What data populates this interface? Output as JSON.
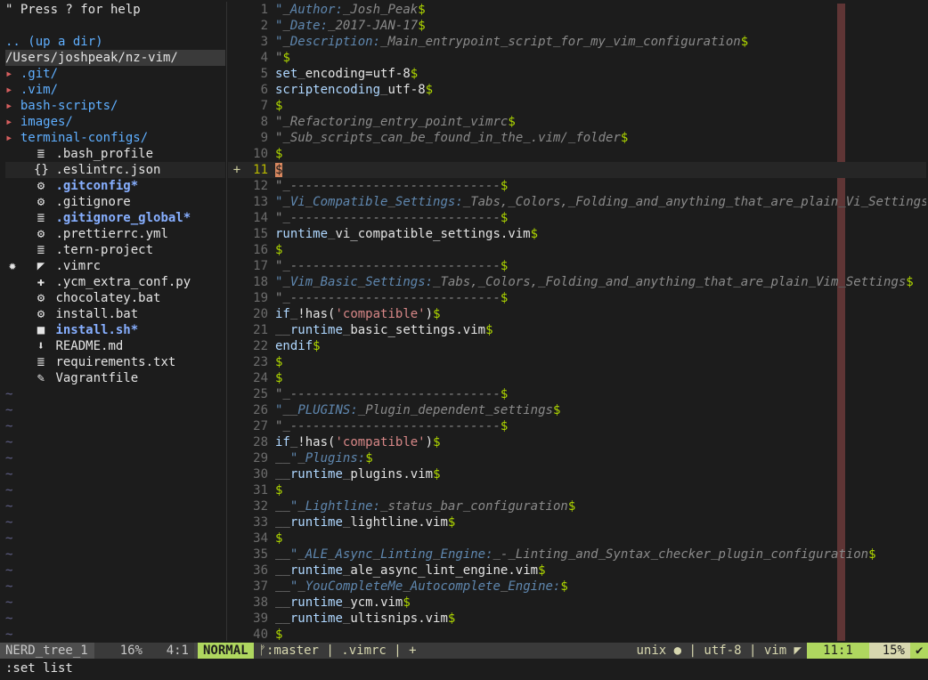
{
  "tree": {
    "help": "\" Press ? for help",
    "updir": ".. (up a dir)",
    "cwd": "/Users/joshpeak/nz-vim/",
    "dirs": [
      ".git/",
      ".vim/",
      "bash-scripts/",
      "images/",
      "terminal-configs/"
    ],
    "files": [
      {
        "icon": "≣",
        "name": ".bash_profile",
        "style": "normal"
      },
      {
        "icon": "{}",
        "name": ".eslintrc.json",
        "style": "current"
      },
      {
        "icon": "⚙",
        "name": ".gitconfig*",
        "style": "exec"
      },
      {
        "icon": "⚙",
        "name": ".gitignore",
        "style": "normal"
      },
      {
        "icon": "≣",
        "name": ".gitignore_global*",
        "style": "exec"
      },
      {
        "icon": "⚙",
        "name": ".prettierrc.yml",
        "style": "normal"
      },
      {
        "icon": "≣",
        "name": ".tern-project",
        "style": "normal"
      },
      {
        "icon": "◤",
        "name": ".vimrc",
        "style": "active",
        "mark": "✹"
      },
      {
        "icon": "✚",
        "name": ".ycm_extra_conf.py",
        "style": "normal"
      },
      {
        "icon": "⚙",
        "name": "chocolatey.bat",
        "style": "normal"
      },
      {
        "icon": "⚙",
        "name": "install.bat",
        "style": "normal"
      },
      {
        "icon": "■",
        "name": "install.sh*",
        "style": "exec"
      },
      {
        "icon": "⬇",
        "name": "README.md",
        "style": "normal"
      },
      {
        "icon": "≣",
        "name": "requirements.txt",
        "style": "normal"
      },
      {
        "icon": "✎",
        "name": "Vagrantfile",
        "style": "normal"
      }
    ],
    "tilde_count": 16
  },
  "gutter": {
    "plus_line": 11,
    "plus_symbol": "+"
  },
  "editor": {
    "current_line": 11,
    "lines": [
      {
        "n": "1",
        "t": "c",
        "text": "\" Author: Josh Peak"
      },
      {
        "n": "2",
        "t": "c",
        "text": "\" Date: 2017-JAN-17"
      },
      {
        "n": "3",
        "t": "c",
        "text": "\" Description: Main entrypoint script for my vim configuration"
      },
      {
        "n": "4",
        "t": "c",
        "text": "\""
      },
      {
        "n": "5",
        "t": "code",
        "text": "set encoding=utf-8"
      },
      {
        "n": "6",
        "t": "code",
        "text": "scriptencoding utf-8"
      },
      {
        "n": "7",
        "t": "blank",
        "text": ""
      },
      {
        "n": "8",
        "t": "c",
        "text": "\" Refactoring entry point vimrc"
      },
      {
        "n": "9",
        "t": "c",
        "text": "\" Sub scripts can be found in the .vim/ folder"
      },
      {
        "n": "10",
        "t": "blank",
        "text": ""
      },
      {
        "n": "11",
        "t": "blank",
        "text": ""
      },
      {
        "n": "12",
        "t": "c",
        "text": "\" ----------------------------"
      },
      {
        "n": "13",
        "t": "c",
        "text": "\" Vi Compatible Settings: Tabs, Colors, Folding and anything that are plain Vi Settings"
      },
      {
        "n": "14",
        "t": "c",
        "text": "\" ----------------------------"
      },
      {
        "n": "15",
        "t": "code",
        "text": "runtime vi_compatible_settings.vim"
      },
      {
        "n": "16",
        "t": "blank",
        "text": ""
      },
      {
        "n": "17",
        "t": "c",
        "text": "\" ----------------------------"
      },
      {
        "n": "18",
        "t": "c",
        "text": "\" Vim Basic Settings: Tabs, Colors, Folding and anything that are plain Vim Settings"
      },
      {
        "n": "19",
        "t": "c",
        "text": "\" ----------------------------"
      },
      {
        "n": "20",
        "t": "code",
        "text": "if !has('compatible')"
      },
      {
        "n": "21",
        "t": "code",
        "text": "  runtime basic_settings.vim"
      },
      {
        "n": "22",
        "t": "code",
        "text": "endif"
      },
      {
        "n": "23",
        "t": "blank",
        "text": ""
      },
      {
        "n": "24",
        "t": "blank",
        "text": ""
      },
      {
        "n": "25",
        "t": "c",
        "text": "\" ----------------------------"
      },
      {
        "n": "26",
        "t": "c",
        "text": "\"  PLUGINS: Plugin dependent settings"
      },
      {
        "n": "27",
        "t": "c",
        "text": "\" ----------------------------"
      },
      {
        "n": "28",
        "t": "code",
        "text": "if !has('compatible')"
      },
      {
        "n": "29",
        "t": "c",
        "text": "  \" Plugins:"
      },
      {
        "n": "30",
        "t": "code",
        "text": "  runtime plugins.vim"
      },
      {
        "n": "31",
        "t": "blank",
        "text": ""
      },
      {
        "n": "32",
        "t": "c",
        "text": "  \" Lightline: status bar configuration"
      },
      {
        "n": "33",
        "t": "code",
        "text": "  runtime lightline.vim"
      },
      {
        "n": "34",
        "t": "blank",
        "text": ""
      },
      {
        "n": "35",
        "t": "c",
        "text": "  \" ALE Async Linting Engine: - Linting and Syntax checker plugin configuration"
      },
      {
        "n": "36",
        "t": "code",
        "text": "  runtime ale_async_lint_engine.vim"
      },
      {
        "n": "37",
        "t": "c",
        "text": "  \" YouCompleteMe Autocomplete Engine:"
      },
      {
        "n": "38",
        "t": "code",
        "text": "  runtime ycm.vim"
      },
      {
        "n": "39",
        "t": "code",
        "text": "  runtime ultisnips.vim"
      },
      {
        "n": "40",
        "t": "blank",
        "text": ""
      }
    ]
  },
  "statusbar": {
    "tree_name": "NERD_tree_1",
    "tree_pct": "16%",
    "tree_pos": "4:1",
    "mode": "NORMAL",
    "branch": "ᚠ:master",
    "filename": ".vimrc",
    "modified": "+",
    "fileformat": "unix ",
    "encoding": "utf-8",
    "filetype": "vim ◤",
    "line_col": "11:1",
    "percent": "15%",
    "ok": "✔"
  },
  "cmdline": ":set list",
  "colors": {
    "accent_green": "#afd75f",
    "colorcolumn": "#5f3535",
    "dir_blue": "#5fafff"
  }
}
